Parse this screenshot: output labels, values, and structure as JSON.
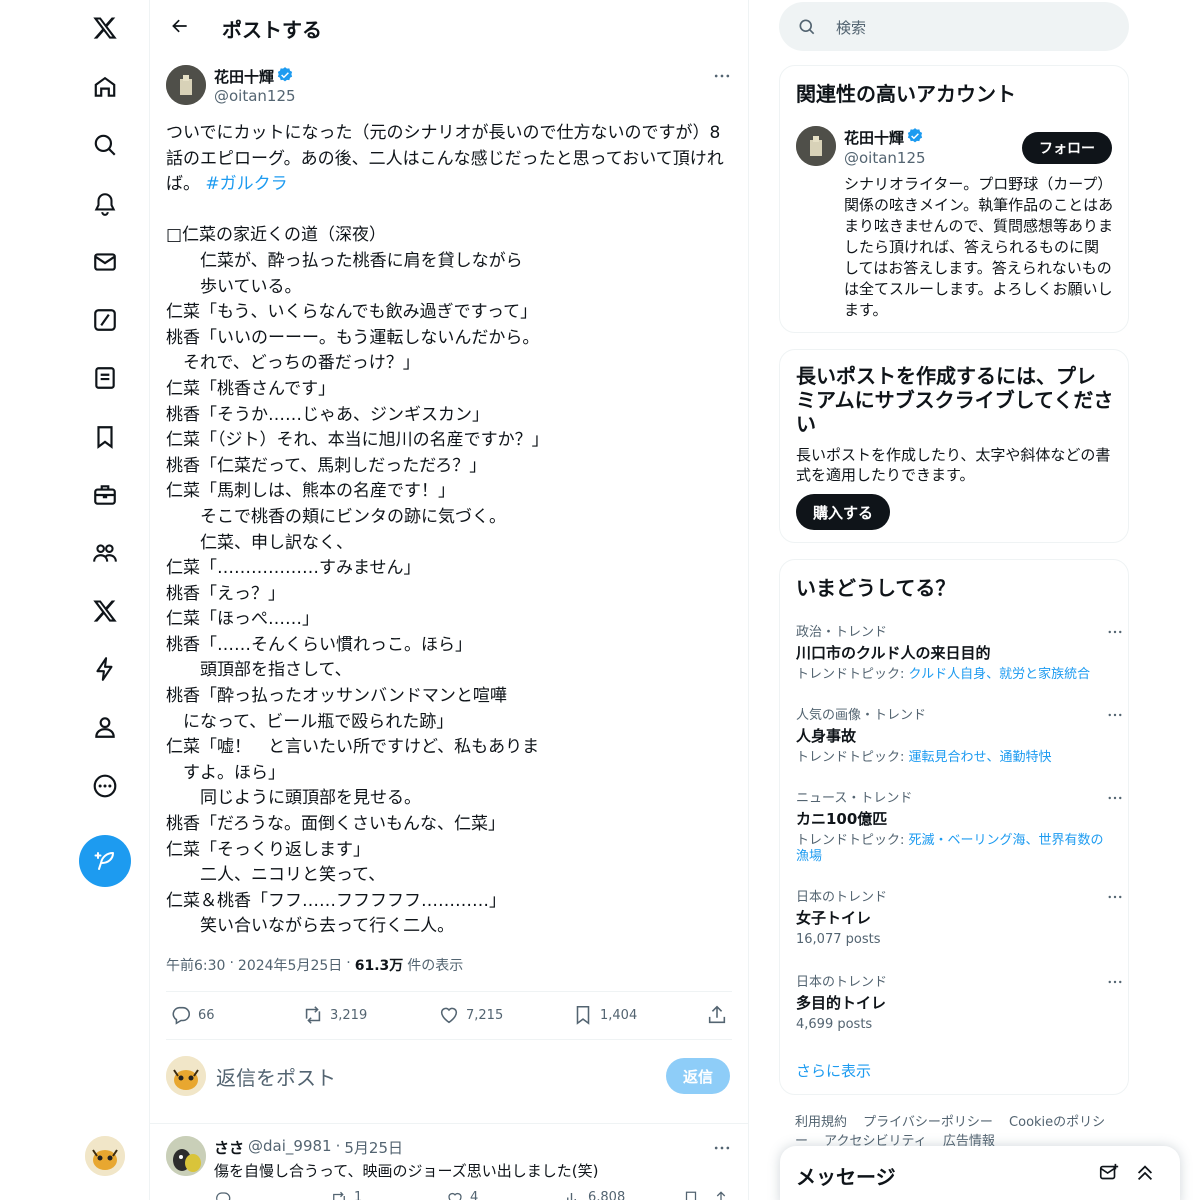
{
  "header": {
    "title": "ポストする"
  },
  "post": {
    "author_name": "花田十輝",
    "author_handle": "@oitan125",
    "text_intro": "ついでにカットになった（元のシナリオが長いので仕方ないのですが）8話のエピローグ。あの後、二人はこんな感じだったと思っておいて頂ければ。",
    "hashtag": "#ガルクラ",
    "text_script": "\n\n□仁菜の家近くの道（深夜）\n　　仁菜が、酔っ払った桃香に肩を貸しながら\n　　歩いている。\n仁菜「もう、いくらなんでも飲み過ぎですって」\n桃香「いいのーーー。もう運転しないんだから。\n　それで、どっちの番だっけ？」\n仁菜「桃香さんです」\n桃香「そうか……じゃあ、ジンギスカン」\n仁菜「（ジト）それ、本当に旭川の名産ですか？」\n桃香「仁菜だって、馬刺しだっただろ？」\n仁菜「馬刺しは、熊本の名産です！」\n　　そこで桃香の頬にビンタの跡に気づく。\n　　仁菜、申し訳なく、\n仁菜「………………すみません」\n桃香「えっ？」\n仁菜「ほっぺ……」\n桃香「……そんくらい慣れっこ。ほら」\n　　頭頂部を指さして、\n桃香「酔っ払ったオッサンバンドマンと喧嘩\n　になって、ビール瓶で殴られた跡」\n仁菜「嘘！　と言いたい所ですけど、私もありま\n　すよ。ほら」\n　　同じように頭頂部を見せる。\n桃香「だろうな。面倒くさいもんな、仁菜」\n仁菜「そっくり返します」\n　　二人、ニコリと笑って、\n仁菜＆桃香「フフ……フフフフフ…………」\n　　笑い合いながら去って行く二人。",
    "time": "午前6:30",
    "date": "2024年5月25日",
    "views_count": "61.3万",
    "views_label": "件の表示",
    "replies": "66",
    "reposts": "3,219",
    "likes": "7,215",
    "bookmarks": "1,404"
  },
  "reply_box": {
    "placeholder": "返信をポスト",
    "button": "返信"
  },
  "comment": {
    "name": "ささ",
    "handle": "@dai_9981",
    "date": "5月25日",
    "text": "傷を自慢し合うって、映画のジョーズ思い出しました(笑)",
    "replies": "",
    "reposts": "1",
    "likes": "4",
    "views": "6,808"
  },
  "search": {
    "placeholder": "検索"
  },
  "relevant": {
    "title": "関連性の高いアカウント",
    "name": "花田十輝",
    "handle": "@oitan125",
    "follow": "フォロー",
    "bio": "シナリオライター。プロ野球（カープ）関係の呟きメイン。執筆作品のことはあまり呟きませんので、質問感想等ありましたら頂ければ、答えられるものに関してはお答えします。答えられないものは全てスルーします。よろしくお願いします。"
  },
  "premium": {
    "title": "長いポストを作成するには、プレミアムにサブスクライブしてください",
    "desc": "長いポストを作成したり、太字や斜体などの書式を適用したりできます。",
    "button": "購入する"
  },
  "trends": {
    "title": "いまどうしてる？",
    "items": [
      {
        "category": "政治・トレンド",
        "name": "川口市のクルド人の来日目的",
        "sub_label": "トレンドトピック: ",
        "sub_links": "クルド人自身、就労と家族統合"
      },
      {
        "category": "人気の画像・トレンド",
        "name": "人身事故",
        "sub_label": "トレンドトピック: ",
        "sub_links": "運転見合わせ、通勤特快"
      },
      {
        "category": "ニュース・トレンド",
        "name": "カニ100億匹",
        "sub_label": "トレンドトピック: ",
        "sub_links": "死滅・ベーリング海、世界有数の漁場"
      },
      {
        "category": "日本のトレンド",
        "name": "女子トイレ",
        "sub_label": "16,077 posts",
        "sub_links": ""
      },
      {
        "category": "日本のトレンド",
        "name": "多目的トイレ",
        "sub_label": "4,699 posts",
        "sub_links": ""
      }
    ],
    "show_more": "さらに表示"
  },
  "footer": {
    "links": [
      "利用規約",
      "プライバシーポリシー",
      "Cookieのポリシー",
      "アクセシビリティ",
      "広告情報"
    ]
  },
  "messages": {
    "title": "メッセージ"
  },
  "colors": {
    "accent": "#1d9bf0",
    "text": "#0f1419",
    "muted": "#536471",
    "border": "#eff3f4"
  }
}
